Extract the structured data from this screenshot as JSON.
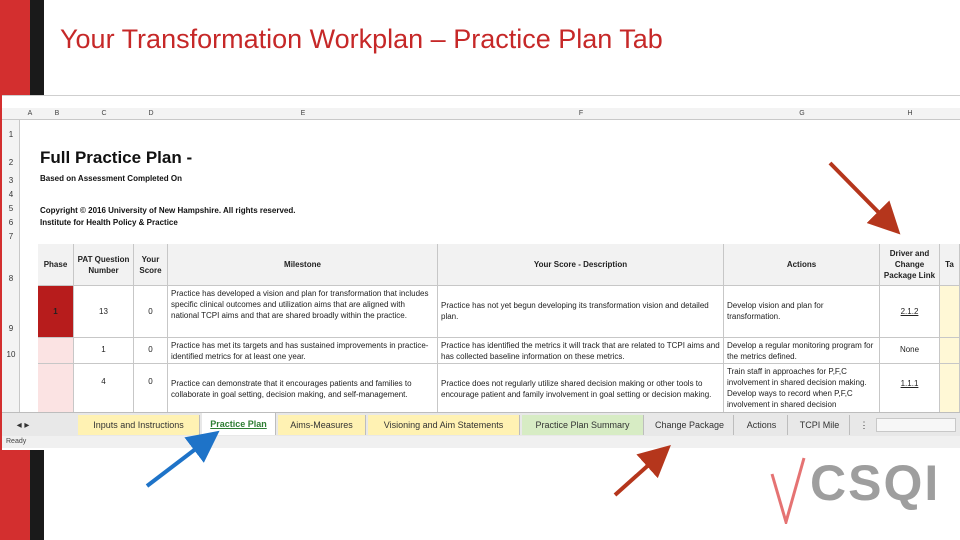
{
  "slide": {
    "title": "Your Transformation Workplan – Practice Plan Tab"
  },
  "spreadsheet": {
    "column_letters": [
      "A",
      "B",
      "C",
      "D",
      "E",
      "F",
      "G",
      "H"
    ],
    "row_numbers": [
      "1",
      "2",
      "3",
      "4",
      "5",
      "6",
      "7",
      "8",
      "9",
      "10"
    ],
    "plan_title": "Full Practice Plan -",
    "assessment_note": "Based on Assessment Completed On",
    "copyright": "Copyright © 2016 University of New Hampshire. All rights reserved.",
    "institute": "Institute for Health Policy & Practice",
    "headers": {
      "phase": "Phase",
      "pat_question": "PAT Question Number",
      "your_score": "Your Score",
      "milestone": "Milestone",
      "score_description": "Your Score - Description",
      "actions": "Actions",
      "driver_link": "Driver and Change Package Link",
      "extra_col": "Ta"
    },
    "rows": [
      {
        "phase": "1",
        "question": "13",
        "score": "0",
        "milestone": "Practice has developed a vision and plan for transformation that includes specific clinical outcomes and utilization aims that are aligned with national TCPI aims and that are shared broadly within the practice.",
        "description": "Practice has not yet begun developing its transformation vision and detailed plan.",
        "actions": "Develop vision and plan for transformation.",
        "link": "2.1.2"
      },
      {
        "phase": "",
        "question": "1",
        "score": "0",
        "milestone": "Practice has met its targets and has sustained improvements in practice-identified metrics for at least one year.",
        "description": "Practice has identified the metrics it will track that are related to TCPI aims and has collected baseline information on these metrics.",
        "actions": "Develop a regular monitoring program for the metrics defined.",
        "link": "None"
      },
      {
        "phase": "",
        "question": "4",
        "score": "0",
        "milestone": "Practice can demonstrate that it encourages patients and families to collaborate in goal setting, decision making, and self-management.",
        "description": "Practice does not regularly utilize shared decision making or other tools to encourage patient and family involvement in goal setting or decision making.",
        "actions": "Train staff in approaches for P,F,C involvement in shared decision making. Develop ways to record when P,F,C involvement in shared decision",
        "link": "1.1.1"
      }
    ],
    "sheet_tabs": [
      "Inputs and Instructions",
      "Practice Plan",
      "Aims-Measures",
      "Visioning and Aim Statements",
      "Practice Plan Summary",
      "Change Package",
      "Actions",
      "TCPI Mile"
    ],
    "active_tab": "Practice Plan",
    "status_text": "Ready"
  },
  "logo": {
    "text": "CSQI"
  },
  "colors": {
    "title_red": "#c62828",
    "side_red": "#d32f2f",
    "phase_red": "#b71c1c",
    "arrow_red": "#b5361c",
    "arrow_blue": "#1e73c8",
    "tab_yellow": "#fff2b3",
    "tab_green": "#d7ecc4"
  }
}
